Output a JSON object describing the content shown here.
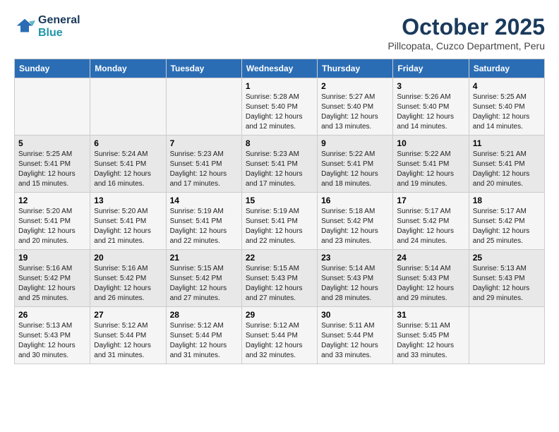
{
  "header": {
    "logo_line1": "General",
    "logo_line2": "Blue",
    "month": "October 2025",
    "location": "Pillcopata, Cuzco Department, Peru"
  },
  "days_of_week": [
    "Sunday",
    "Monday",
    "Tuesday",
    "Wednesday",
    "Thursday",
    "Friday",
    "Saturday"
  ],
  "weeks": [
    [
      {
        "day": "",
        "info": ""
      },
      {
        "day": "",
        "info": ""
      },
      {
        "day": "",
        "info": ""
      },
      {
        "day": "1",
        "info": "Sunrise: 5:28 AM\nSunset: 5:40 PM\nDaylight: 12 hours and 12 minutes."
      },
      {
        "day": "2",
        "info": "Sunrise: 5:27 AM\nSunset: 5:40 PM\nDaylight: 12 hours and 13 minutes."
      },
      {
        "day": "3",
        "info": "Sunrise: 5:26 AM\nSunset: 5:40 PM\nDaylight: 12 hours and 14 minutes."
      },
      {
        "day": "4",
        "info": "Sunrise: 5:25 AM\nSunset: 5:40 PM\nDaylight: 12 hours and 14 minutes."
      }
    ],
    [
      {
        "day": "5",
        "info": "Sunrise: 5:25 AM\nSunset: 5:41 PM\nDaylight: 12 hours and 15 minutes."
      },
      {
        "day": "6",
        "info": "Sunrise: 5:24 AM\nSunset: 5:41 PM\nDaylight: 12 hours and 16 minutes."
      },
      {
        "day": "7",
        "info": "Sunrise: 5:23 AM\nSunset: 5:41 PM\nDaylight: 12 hours and 17 minutes."
      },
      {
        "day": "8",
        "info": "Sunrise: 5:23 AM\nSunset: 5:41 PM\nDaylight: 12 hours and 17 minutes."
      },
      {
        "day": "9",
        "info": "Sunrise: 5:22 AM\nSunset: 5:41 PM\nDaylight: 12 hours and 18 minutes."
      },
      {
        "day": "10",
        "info": "Sunrise: 5:22 AM\nSunset: 5:41 PM\nDaylight: 12 hours and 19 minutes."
      },
      {
        "day": "11",
        "info": "Sunrise: 5:21 AM\nSunset: 5:41 PM\nDaylight: 12 hours and 20 minutes."
      }
    ],
    [
      {
        "day": "12",
        "info": "Sunrise: 5:20 AM\nSunset: 5:41 PM\nDaylight: 12 hours and 20 minutes."
      },
      {
        "day": "13",
        "info": "Sunrise: 5:20 AM\nSunset: 5:41 PM\nDaylight: 12 hours and 21 minutes."
      },
      {
        "day": "14",
        "info": "Sunrise: 5:19 AM\nSunset: 5:41 PM\nDaylight: 12 hours and 22 minutes."
      },
      {
        "day": "15",
        "info": "Sunrise: 5:19 AM\nSunset: 5:41 PM\nDaylight: 12 hours and 22 minutes."
      },
      {
        "day": "16",
        "info": "Sunrise: 5:18 AM\nSunset: 5:42 PM\nDaylight: 12 hours and 23 minutes."
      },
      {
        "day": "17",
        "info": "Sunrise: 5:17 AM\nSunset: 5:42 PM\nDaylight: 12 hours and 24 minutes."
      },
      {
        "day": "18",
        "info": "Sunrise: 5:17 AM\nSunset: 5:42 PM\nDaylight: 12 hours and 25 minutes."
      }
    ],
    [
      {
        "day": "19",
        "info": "Sunrise: 5:16 AM\nSunset: 5:42 PM\nDaylight: 12 hours and 25 minutes."
      },
      {
        "day": "20",
        "info": "Sunrise: 5:16 AM\nSunset: 5:42 PM\nDaylight: 12 hours and 26 minutes."
      },
      {
        "day": "21",
        "info": "Sunrise: 5:15 AM\nSunset: 5:42 PM\nDaylight: 12 hours and 27 minutes."
      },
      {
        "day": "22",
        "info": "Sunrise: 5:15 AM\nSunset: 5:43 PM\nDaylight: 12 hours and 27 minutes."
      },
      {
        "day": "23",
        "info": "Sunrise: 5:14 AM\nSunset: 5:43 PM\nDaylight: 12 hours and 28 minutes."
      },
      {
        "day": "24",
        "info": "Sunrise: 5:14 AM\nSunset: 5:43 PM\nDaylight: 12 hours and 29 minutes."
      },
      {
        "day": "25",
        "info": "Sunrise: 5:13 AM\nSunset: 5:43 PM\nDaylight: 12 hours and 29 minutes."
      }
    ],
    [
      {
        "day": "26",
        "info": "Sunrise: 5:13 AM\nSunset: 5:43 PM\nDaylight: 12 hours and 30 minutes."
      },
      {
        "day": "27",
        "info": "Sunrise: 5:12 AM\nSunset: 5:44 PM\nDaylight: 12 hours and 31 minutes."
      },
      {
        "day": "28",
        "info": "Sunrise: 5:12 AM\nSunset: 5:44 PM\nDaylight: 12 hours and 31 minutes."
      },
      {
        "day": "29",
        "info": "Sunrise: 5:12 AM\nSunset: 5:44 PM\nDaylight: 12 hours and 32 minutes."
      },
      {
        "day": "30",
        "info": "Sunrise: 5:11 AM\nSunset: 5:44 PM\nDaylight: 12 hours and 33 minutes."
      },
      {
        "day": "31",
        "info": "Sunrise: 5:11 AM\nSunset: 5:45 PM\nDaylight: 12 hours and 33 minutes."
      },
      {
        "day": "",
        "info": ""
      }
    ]
  ]
}
